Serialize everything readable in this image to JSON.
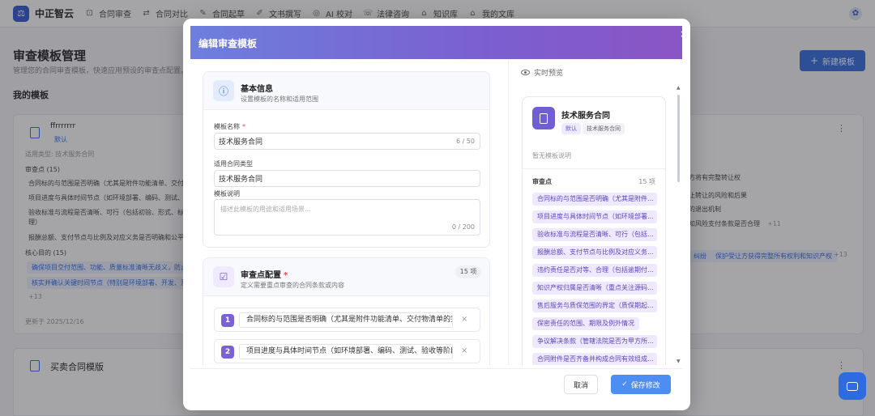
{
  "app": {
    "name": "中正智云",
    "logo_glyph": "⚖",
    "avatar_glyph": "✿"
  },
  "nav": {
    "items": [
      {
        "label": "合同审查",
        "icon": "⊡"
      },
      {
        "label": "合同对比",
        "icon": "⇄"
      },
      {
        "label": "合同起草",
        "icon": "✎"
      },
      {
        "label": "文书撰写",
        "icon": "✐"
      },
      {
        "label": "AI 校对",
        "icon": "◎"
      },
      {
        "label": "法律咨询",
        "icon": "☏"
      },
      {
        "label": "知识库",
        "icon": "⌂"
      },
      {
        "label": "我的文库",
        "icon": "⌂"
      }
    ]
  },
  "background": {
    "page_title": "审查模板管理",
    "page_subtitle": "管理您的合同审查模板，快速应用预设的审查点配置。",
    "my_templates": "我的模板",
    "new_button": "新建模板",
    "card1": {
      "name": "ffrrrrrrr",
      "tag": "默认",
      "type_line": "适用类型: 技术服务合同",
      "cp_header": "审查点 (15)",
      "cp_lines": [
        "合同标的与范围是否明确（尤其是附件功能清单、交付物清单…",
        "项目进度与具体时间节点（如环境部署、编码、测试、验收…",
        "验收标准与流程是否清晰、可行（包括初验、形式、标准…",
        "理）",
        "报酬总额、支付节点与比例及对应义务是否明确和公平"
      ],
      "right_lines": [
        "方将有完整转让权",
        "止转让的风险和后果",
        "的退出机制",
        "知风险支付条款是否合理"
      ],
      "right_more": "+11",
      "goal_header": "核心目的 (15)",
      "goal_tags": [
        "确保项目交付范围、功能、质量标准清晰无歧义，防止需求…",
        "核实并确认关键时间节点（特别是环境部署、开发、测试…"
      ],
      "goal_right_tags": [
        "纠纷",
        "保护受让方获得完整所有权利和知识产权"
      ],
      "goal_right_more": "+13",
      "goal_more": "+13",
      "updated": "更新于 2025/12/16"
    },
    "card2": {
      "name": "买卖合同模版"
    }
  },
  "modal": {
    "title": "编辑审查模板",
    "close": "×",
    "basic": {
      "icon": "ⓘ",
      "title": "基本信息",
      "subtitle": "设置模板的名称和适用范围",
      "name_label": "模板名称",
      "name_required": "*",
      "name_value": "技术服务合同",
      "name_count": "6 / 50",
      "type_label": "适用合同类型",
      "type_value": "技术服务合同",
      "desc_label": "模板说明",
      "desc_placeholder": "描述此模板的用途和适用场景...",
      "desc_count": "0 / 200"
    },
    "checkpoints": {
      "icon": "☑",
      "title": "审查点配置",
      "required": "*",
      "subtitle": "定义需要重点审查的合同条款或内容",
      "count": "15 项",
      "items": [
        {
          "num": "1",
          "text": "合同标的与范围是否明确（尤其是附件功能清单、交付物清单的完"
        },
        {
          "num": "2",
          "text": "项目进度与具体时间节点（如环境部署、编码、测试、验收等阶段"
        }
      ],
      "remove": "×"
    },
    "preview": {
      "label": "实时预览",
      "title": "技术服务合同",
      "tag_default": "默认",
      "tag_type": "技术服务合同",
      "desc": "暂无模板说明",
      "cp_label": "审查点",
      "cp_count": "15 项",
      "chips": [
        "合同标的与范围是否明确（尤其是附件…",
        "项目进度与具体时间节点（如环境部署…",
        "验收标准与流程是否清晰、可行（包括…",
        "报酬总额、支付节点与比例及对应义务…",
        "违约责任是否对等、合理（包括逾期付…",
        "知识产权归属是否清晰（重点关注源码…",
        "售后服务与质保范围的界定（质保期起…",
        "保密责任的范围、期限及例外情况",
        "争议解决条款（管辖法院是否为甲方所…",
        "合同附件是否齐备并构成合同有效组成…"
      ]
    },
    "footer": {
      "cancel": "取消",
      "save": "保存修改",
      "save_icon": "✓"
    }
  }
}
